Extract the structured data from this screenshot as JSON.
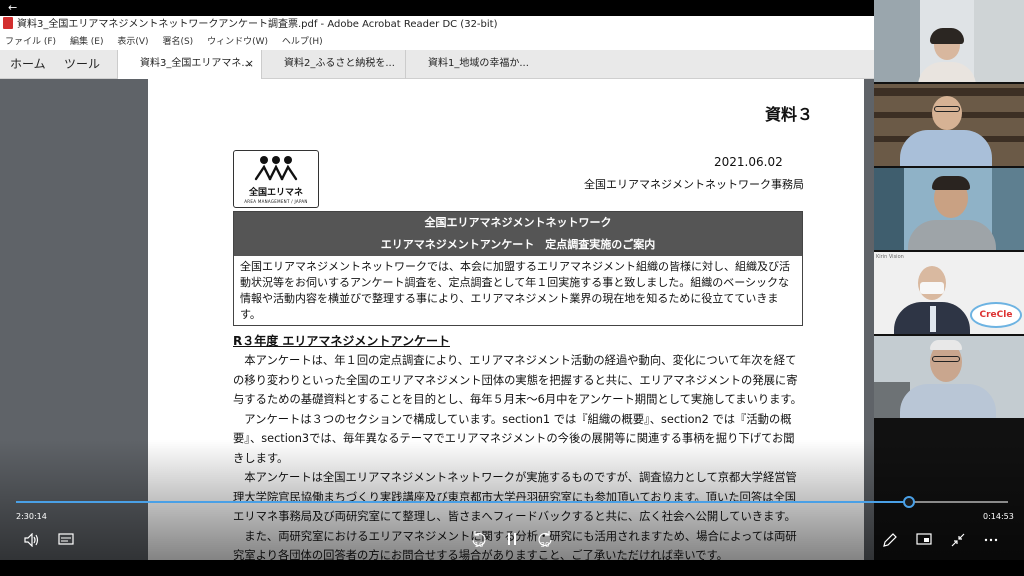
{
  "window": {
    "title": "資料3_全国エリアマネジメントネットワークアンケート調査票.pdf - Adobe Acrobat Reader DC (32-bit)"
  },
  "menu": [
    "ファイル (F)",
    "編集 (E)",
    "表示(V)",
    "署名(S)",
    "ウィンドウ(W)",
    "ヘルプ(H)"
  ],
  "tabs": {
    "home": "ホーム",
    "tools": "ツール",
    "docs": [
      "資料3_全国エリアマネ...",
      "資料2_ふるさと納税を...",
      "資料1_地域の幸福か..."
    ],
    "close_glyph": "×"
  },
  "document": {
    "label": "資料３",
    "logo": {
      "name": "全国エリマネ",
      "sub": "AREA MANAGEMENT / JAPAN"
    },
    "date": "2021.06.02",
    "office": "全国エリアマネジメントネットワーク事務局",
    "box_title_1": "全国エリアマネジメントネットワーク",
    "box_title_2": "エリアマネジメントアンケート　定点調査実施のご案内",
    "box_body": "全国エリアマネジメントネットワークでは、本会に加盟するエリアマネジメント組織の皆様に対し、組織及び活動状況等をお伺いするアンケート調査を、定点調査として年１回実施する事と致しました。組織のベーシックな情報や活動内容を横並びで整理する事により、エリアマネジメント業界の現在地を知るために役立てていきます。",
    "section_title": "R３年度 エリアマネジメントアンケート",
    "para_1": "本アンケートは、年１回の定点調査により、エリアマネジメント活動の経過や動向、変化について年次を経ての移り変わりといった全国のエリアマネジメント団体の実態を把握すると共に、エリアマネジメントの発展に寄与するための基礎資料とすることを目的とし、毎年５月末～6月中をアンケート期間として実施してまいります。",
    "para_2": "アンケートは３つのセクションで構成しています。section1 では『組織の概要』、section2 では『活動の概要』、section3では、毎年異なるテーマでエリアマネジメントの今後の展開等に関連する事柄を掘り下げてお聞きします。",
    "para_3": "本アンケートは全国エリアマネジメントネットワークが実施するものですが、調査協力として京都大学経営管理大学院官民協働まちづくり実践講座及び東京都市大学丹羽研究室にも参加頂いております。頂いた回答は全国エリマネ事務局及び両研究室にて整理し、皆さまへフィードバックすると共に、広く社会へ公開していきます。",
    "para_4": "また、両研究室におけるエリアマネジメントに関する分析・研究にも活用されますため、場合によっては両研究室より各団体の回答者の方にお問合せする場合がありますこと、ご了承いただければ幸いです。"
  },
  "player": {
    "elapsed": "2:30:14",
    "remaining": "0:14:53",
    "progress": 0.9,
    "skip_back_seconds": "10",
    "skip_forward_seconds": "30",
    "accent": "#4aa0e6"
  },
  "participants": [
    {
      "name_tag": ""
    },
    {
      "name_tag": ""
    },
    {
      "name_tag": ""
    },
    {
      "name_tag": "Kirin Vision"
    },
    {
      "name_tag": ""
    }
  ],
  "participant_sign": "CreCle"
}
